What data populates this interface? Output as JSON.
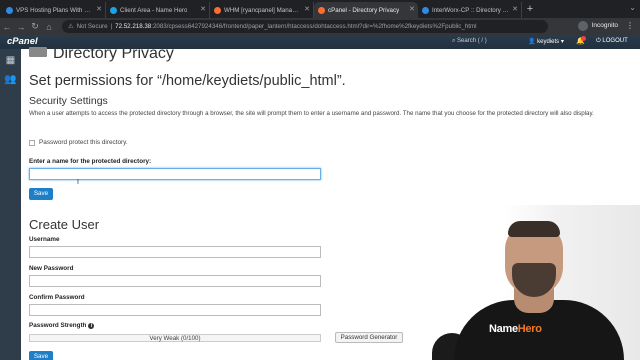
{
  "browser": {
    "tabs": [
      {
        "label": "VPS Hosting Plans With Free S",
        "color": "#2d8ae8",
        "active": false
      },
      {
        "label": "Client Area - Name Hero",
        "color": "#1aa3e8",
        "active": false
      },
      {
        "label": "WHM [ryancpanel] Manage Au",
        "color": "#ff6c2c",
        "active": false
      },
      {
        "label": "cPanel - Directory Privacy",
        "color": "#ff6c2c",
        "active": true
      },
      {
        "label": "InterWorx-CP :: Directory Opti",
        "color": "#2d8ae8",
        "active": false
      }
    ],
    "security_label": "Not Secure",
    "url_host": "72.52.218.38",
    "url_path": ":2083/cpsess6427924346/frontend/paper_lantern/htaccess/dohtaccess.html?dir=%2fhome%2fkeydiets%2Fpublic_html",
    "incognito_label": "Incognito"
  },
  "cpanel": {
    "logo": "cPanel",
    "search_placeholder": "Search ( / )",
    "user": "keydiets",
    "logout": "LOGOUT"
  },
  "page": {
    "title": "Directory Privacy",
    "permissions_heading": "Set permissions for “/home/keydiets/public_html”.",
    "security_heading": "Security Settings",
    "description": "When a user attempts to access the protected directory through a browser, the site will prompt them to enter a username and password. The name that you choose for the protected directory will also display.",
    "protect_checkbox_label": "Password protect this directory.",
    "name_label": "Enter a name for the protected directory:",
    "save_label": "Save",
    "create_user_heading": "Create User",
    "username_label": "Username",
    "new_password_label": "New Password",
    "confirm_password_label": "Confirm Password",
    "strength_label": "Password Strength",
    "strength_value": "Very Weak (0/100)",
    "generator_label": "Password Generator",
    "save2_label": "Save"
  },
  "webcam": {
    "brand_name": "Name",
    "brand_hero": "Hero"
  }
}
